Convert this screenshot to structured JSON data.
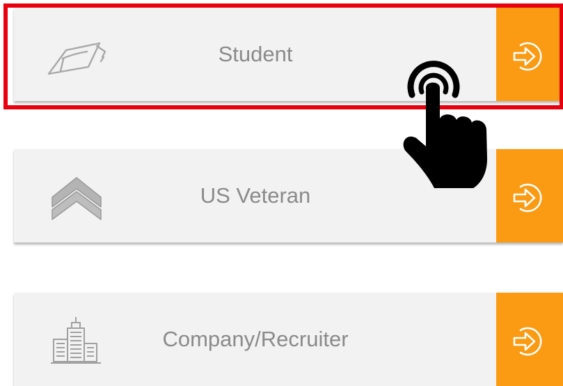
{
  "options": [
    {
      "id": "student",
      "label": "Student",
      "icon": "graduation-cap-icon"
    },
    {
      "id": "veteran",
      "label": "US Veteran",
      "icon": "chevron-rank-icon"
    },
    {
      "id": "company",
      "label": "Company/Recruiter",
      "icon": "building-icon"
    }
  ],
  "colors": {
    "accent": "#fb9a13",
    "card_bg": "#f2f2f2",
    "label_text": "#8a8a8a",
    "highlight": "#e8000e",
    "cursor": "#000000"
  },
  "enter_icon": "arrow-enter-circle-icon",
  "cursor_icon": "hand-pointer-tap-icon",
  "highlighted_option": "student"
}
